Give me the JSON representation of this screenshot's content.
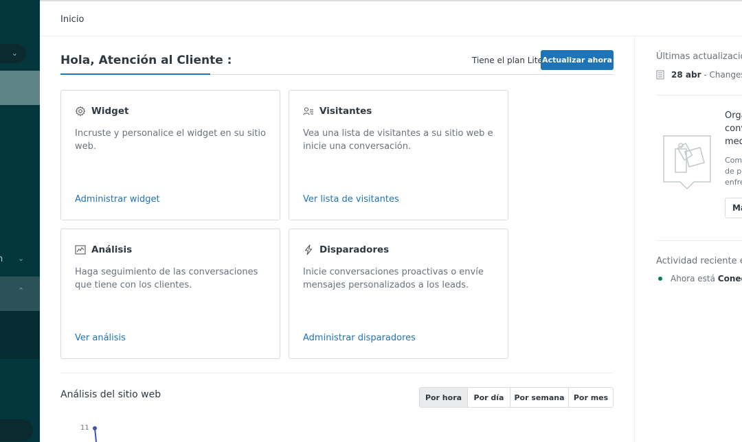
{
  "header": {
    "title": "Inicio"
  },
  "sidebar": {
    "item_partial_label": "n"
  },
  "main": {
    "greeting": "Hola, Atención al Cliente :",
    "plan_text": "Tiene el plan Lite",
    "upgrade_label": "Actualizar ahora",
    "cards": [
      {
        "title": "Widget",
        "icon": "gear-icon",
        "description": "Incruste y personalice el widget en su sitio web.",
        "link": "Administrar widget"
      },
      {
        "title": "Visitantes",
        "icon": "visitors-icon",
        "description": "Vea una lista de visitantes a su sitio web e inicie una conversación.",
        "link": "Ver lista de visitantes"
      },
      {
        "title": "Análisis",
        "icon": "chart-icon",
        "description": "Haga seguimiento de las conversaciones que tiene con los clientes.",
        "link": "Ver análisis"
      },
      {
        "title": "Disparadores",
        "icon": "lightning-icon",
        "description": "Inicie conversaciones proactivas o envíe mensajes personalizados a los leads.",
        "link": "Administrar disparadores"
      }
    ],
    "analytics": {
      "title": "Análisis del sitio web",
      "periods": [
        "Por hora",
        "Por día",
        "Por semana",
        "Por mes"
      ],
      "selected_period": "Por hora",
      "chart_first_tick": "11"
    }
  },
  "right_panel": {
    "updates_title": "Últimas actualizacione",
    "update_date": "28 abr",
    "update_text": "- Changes t",
    "promo_title_lines": [
      "Orga",
      "conv",
      "med"
    ],
    "promo_desc_lines": [
      "Comp",
      "de p",
      "enfre"
    ],
    "promo_button": "Má",
    "activity_title": "Actividad reciente en",
    "status_prefix": "Ahora está",
    "status_value": "Conecta"
  },
  "colors": {
    "sidebar": "#03363d",
    "accent": "#1f73b7",
    "online": "#038153"
  }
}
